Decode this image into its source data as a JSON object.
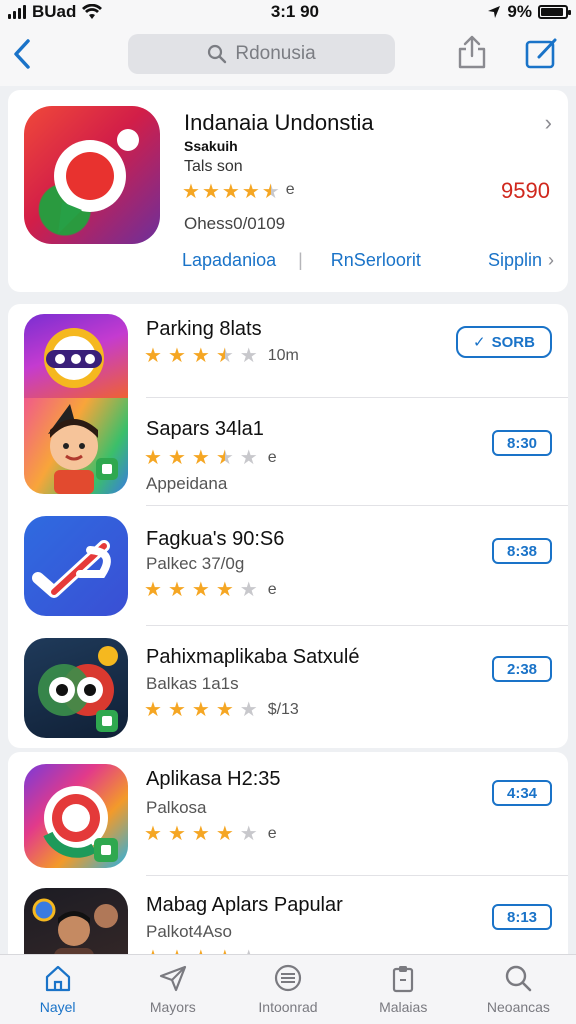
{
  "status_bar": {
    "carrier": "BUad",
    "time": "3:1 90",
    "battery": "9%",
    "battery_level": 0.9
  },
  "nav": {
    "search_text": "Rdonusia"
  },
  "featured": {
    "title": "Indanaia Undonstia",
    "subtitle": "Ssakuih",
    "developer": "Tals son",
    "rating": 4.5,
    "rating_extra": "e",
    "meta": "Ohess0/0109",
    "price": "9590",
    "links": [
      "Lapadanioa",
      "RnSerloorit",
      "Sipplin"
    ]
  },
  "apps": [
    {
      "name": "Parking 8lats",
      "rating": 3.5,
      "rating_extra": "10m",
      "subtitle": "",
      "button": "SORB",
      "button_type": "get"
    },
    {
      "name": "Sapars 34la1",
      "rating": 3.5,
      "rating_extra": "e",
      "subtitle": "Appeidana",
      "button": "8:30",
      "button_type": "price"
    },
    {
      "name": "Fagkua's 90:S6",
      "rating": 4,
      "rating_extra": "e",
      "subtitle": "Palkec 37/0g",
      "button": "8:38",
      "button_type": "price"
    },
    {
      "name": "Pahixmaplikaba Satxulé",
      "rating": 4,
      "rating_extra": "$/13",
      "subtitle": "Balkas 1a1s",
      "button": "2:38",
      "button_type": "price"
    },
    {
      "name": "Aplikasa H2:35",
      "rating": 4,
      "rating_extra": "e",
      "subtitle": "Palkosa",
      "button": "4:34",
      "button_type": "price"
    },
    {
      "name": "Mabag Aplars Papular",
      "rating": 4,
      "rating_extra": "",
      "subtitle": "Palkot4Aso",
      "button": "8:13",
      "button_type": "price"
    }
  ],
  "tabs": [
    {
      "label": "Nayel",
      "icon": "home-icon",
      "active": true
    },
    {
      "label": "Mayors",
      "icon": "send-icon",
      "active": false
    },
    {
      "label": "Intoonrad",
      "icon": "archive-icon",
      "active": false
    },
    {
      "label": "Malaias",
      "icon": "clipboard-icon",
      "active": false
    },
    {
      "label": "Neoancas",
      "icon": "search-icon",
      "active": false
    }
  ],
  "colors": {
    "accent": "#1a73c8",
    "price": "#d0281d",
    "star": "#f5a623"
  }
}
